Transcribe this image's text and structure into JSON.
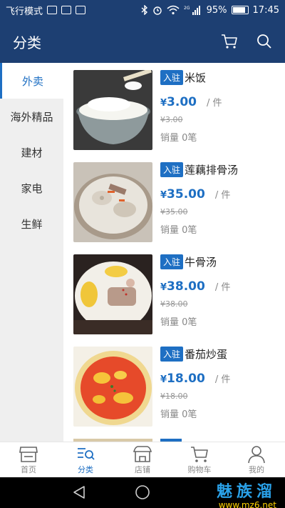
{
  "status": {
    "left_text": "飞行模式",
    "battery": "95%",
    "time": "17:45",
    "signal_tag": "2G"
  },
  "header": {
    "title": "分类"
  },
  "sidebar": {
    "items": [
      {
        "label": "外卖",
        "active": true
      },
      {
        "label": "海外精品"
      },
      {
        "label": "建材"
      },
      {
        "label": "家电"
      },
      {
        "label": "生鲜"
      }
    ]
  },
  "products": [
    {
      "badge": "入驻",
      "name": "米饭",
      "currency": "¥",
      "price": "3.00",
      "unit": "/ 件",
      "old_price": "¥3.00",
      "sales": "销量 0笔"
    },
    {
      "badge": "入驻",
      "name": "莲藕排骨汤",
      "currency": "¥",
      "price": "35.00",
      "unit": "/ 件",
      "old_price": "¥35.00",
      "sales": "销量 0笔"
    },
    {
      "badge": "入驻",
      "name": "牛骨汤",
      "currency": "¥",
      "price": "38.00",
      "unit": "/ 件",
      "old_price": "¥38.00",
      "sales": "销量 0笔"
    },
    {
      "badge": "入驻",
      "name": "番茄炒蛋",
      "currency": "¥",
      "price": "18.00",
      "unit": "/ 件",
      "old_price": "¥18.00",
      "sales": "销量 0笔"
    }
  ],
  "tabs": [
    {
      "label": "首页",
      "icon": "store-icon"
    },
    {
      "label": "分类",
      "icon": "category-search-icon",
      "active": true
    },
    {
      "label": "店铺",
      "icon": "shop-icon"
    },
    {
      "label": "购物车",
      "icon": "cart-icon"
    },
    {
      "label": "我的",
      "icon": "user-icon"
    }
  ],
  "watermark": {
    "line1": "魅族溜",
    "line2": "www.mz6.net"
  },
  "colors": {
    "header_bg": "#1d3f72",
    "accent": "#1e6fc3",
    "sidebar_bg": "#efefef"
  }
}
